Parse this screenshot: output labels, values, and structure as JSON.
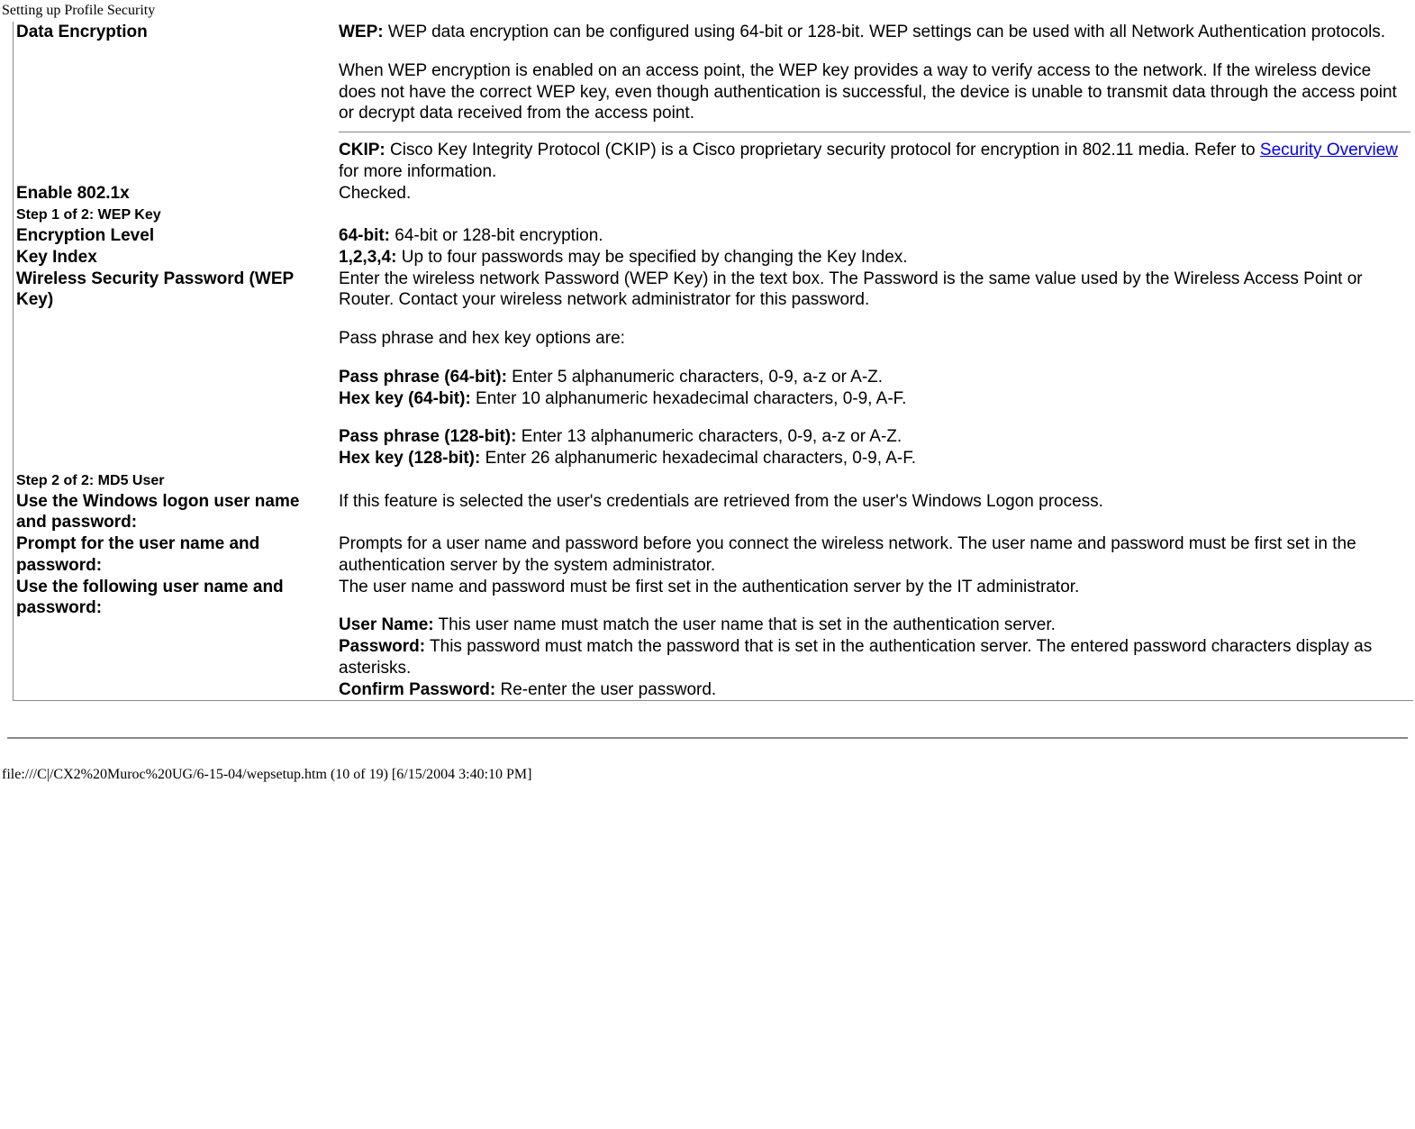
{
  "header": "Setting up Profile Security",
  "rows": {
    "data_encryption": {
      "label": "Data Encryption",
      "wep_bold": "WEP:",
      "wep_text": " WEP data encryption can be configured using 64-bit or 128-bit. WEP settings can be used with all Network Authentication protocols.",
      "wep_para2": "When WEP encryption is enabled on an access point, the WEP key provides a way to verify access to the network. If the wireless device does not have the correct WEP key, even though authentication is successful, the device is unable to transmit data through the access point or decrypt data received from the access point.",
      "ckip_bold": "CKIP:",
      "ckip_text_before": " Cisco Key Integrity Protocol (CKIP) is a Cisco proprietary security protocol for encryption in 802.11 media. Refer to ",
      "ckip_link": "Security Overview",
      "ckip_text_after": " for more information."
    },
    "enable_8021x": {
      "label": "Enable 802.1x",
      "value": "Checked."
    },
    "step1": {
      "label": "Step 1 of 2: WEP Key"
    },
    "encryption_level": {
      "label": "Encryption Level",
      "bold": "64-bit:",
      "text": " 64-bit or 128-bit encryption."
    },
    "key_index": {
      "label": "Key Index",
      "bold": "1,2,3,4:",
      "text": " Up to four passwords may be specified by changing the Key Index."
    },
    "wep_key": {
      "label": "Wireless Security Password (WEP Key)",
      "intro": "Enter the wireless network Password (WEP Key) in the text box. The Password is the same value used by the Wireless Access Point or Router. Contact your wireless network administrator for this password.",
      "options_intro": "Pass phrase and hex key options are:",
      "pp64_bold": "Pass phrase (64-bit):",
      "pp64_text": " Enter 5 alphanumeric characters, 0-9, a-z or A-Z.",
      "hk64_bold": "Hex key (64-bit):",
      "hk64_text": " Enter 10 alphanumeric hexadecimal characters, 0-9, A-F.",
      "pp128_bold": "Pass phrase (128-bit):",
      "pp128_text": " Enter 13 alphanumeric characters, 0-9, a-z or A-Z.",
      "hk128_bold": "Hex key (128-bit):",
      "hk128_text": " Enter 26 alphanumeric hexadecimal characters, 0-9, A-F."
    },
    "step2": {
      "label": "Step 2 of 2: MD5 User"
    },
    "use_windows": {
      "label": "Use the Windows logon user name and password:",
      "text": "If this feature is selected the user's credentials are retrieved from the user's Windows Logon process."
    },
    "prompt": {
      "label": "Prompt for the user name and password:",
      "text": "Prompts for a user name and password before you connect the wireless network. The user name and password must be first set in the authentication server by the system administrator."
    },
    "use_following": {
      "label": "Use the following user name and password:",
      "intro": "The user name and password must be first set in the authentication server by the IT administrator.",
      "un_bold": "User Name:",
      "un_text": " This user name must match the user name that is set in the authentication server.",
      "pw_bold": "Password:",
      "pw_text": " This password must match the password that is set in the authentication server. The entered password characters display as asterisks.",
      "cpw_bold": "Confirm Password:",
      "cpw_text": " Re-enter the user password."
    }
  },
  "footer": "file:///C|/CX2%20Muroc%20UG/6-15-04/wepsetup.htm (10 of 19) [6/15/2004 3:40:10 PM]"
}
